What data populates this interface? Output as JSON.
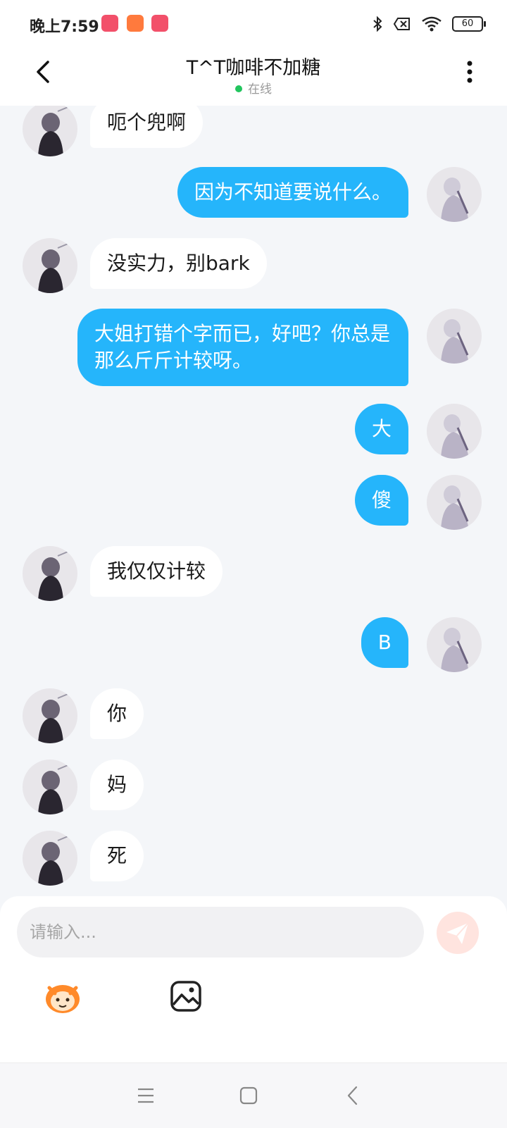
{
  "status_bar": {
    "time": "晚上7:59",
    "battery": "60",
    "icons": [
      "app-badge-icon",
      "app-badge-icon",
      "app-badge-icon",
      "bluetooth-icon",
      "sim-x-icon",
      "wifi-icon",
      "battery-icon"
    ]
  },
  "header": {
    "title": "T^T咖啡不加糖",
    "status": "在线",
    "back_icon": "chevron-left-icon",
    "more_icon": "more-vertical-icon"
  },
  "messages": [
    {
      "side": "in",
      "text": "呃个兜啊"
    },
    {
      "side": "out",
      "text": "因为不知道要说什么。"
    },
    {
      "side": "in",
      "text": "没实力，别bark"
    },
    {
      "side": "out",
      "text": "大姐打错个字而已，好吧？你总是那么斤斤计较呀。"
    },
    {
      "side": "out",
      "text": "大"
    },
    {
      "side": "out",
      "text": "傻"
    },
    {
      "side": "in",
      "text": "我仅仅计较"
    },
    {
      "side": "out",
      "text": "B"
    },
    {
      "side": "in",
      "text": "你"
    },
    {
      "side": "in",
      "text": "妈"
    },
    {
      "side": "in",
      "text": "死"
    }
  ],
  "composer": {
    "placeholder": "请输入...",
    "send_icon": "send-icon",
    "emoji_icon": "emoji-mascot-icon",
    "image_icon": "image-icon"
  },
  "navbar": {
    "icons": [
      "menu-icon",
      "home-square-icon",
      "back-icon"
    ]
  },
  "colors": {
    "outgoing_bubble": "#25b5fb",
    "incoming_bubble": "#ffffff",
    "chat_background": "#f4f6f9",
    "online_dot": "#22c55e"
  }
}
